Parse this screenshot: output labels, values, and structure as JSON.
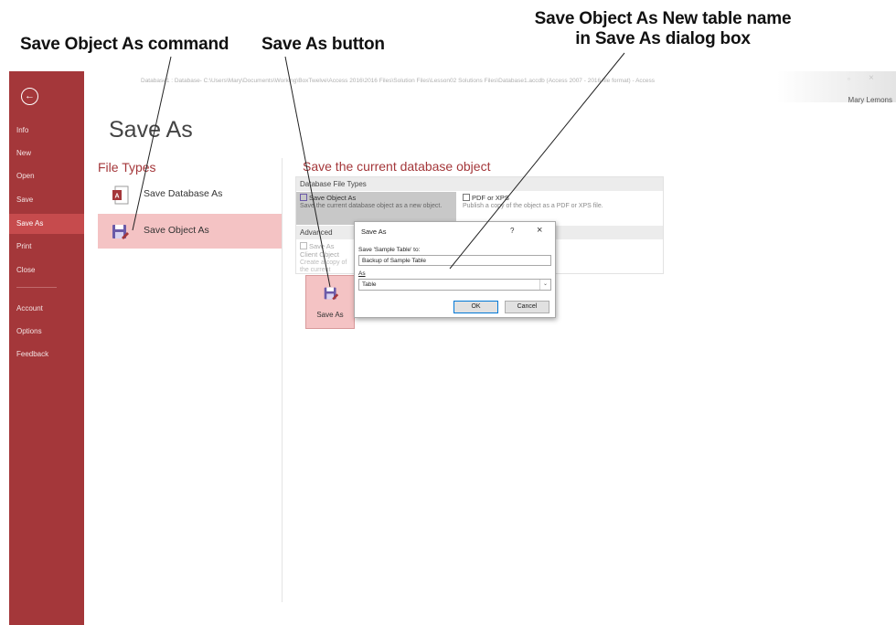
{
  "callouts": {
    "save_object_as_command": "Save Object As command",
    "save_as_button": "Save As button",
    "new_table_name_line1": "Save Object As  New table name",
    "new_table_name_line2": "in Save As dialog box"
  },
  "window": {
    "title": "Database1 : Database- C:\\Users\\Mary\\Documents\\Working\\BoxTwelve\\Access 2016\\2016 Files\\Solution Files\\Lesson02 Solutions Files\\Database1.accdb (Access 2007 - 2016 file format) - Access",
    "help_glyph": "?",
    "close_glyph": "×",
    "restore_glyph": "▫",
    "user": "Mary Lemons"
  },
  "sidebar": {
    "back_glyph": "←",
    "items": [
      {
        "label": "Info"
      },
      {
        "label": "New"
      },
      {
        "label": "Open"
      },
      {
        "label": "Save"
      },
      {
        "label": "Save As"
      },
      {
        "label": "Print"
      },
      {
        "label": "Close"
      },
      {
        "label": "Account"
      },
      {
        "label": "Options"
      },
      {
        "label": "Feedback"
      }
    ]
  },
  "main": {
    "title": "Save As",
    "file_types_heading": "File Types",
    "file_types": [
      {
        "label": "Save Database As"
      },
      {
        "label": "Save Object As"
      }
    ],
    "current_heading": "Save the current database object",
    "db_file_types_header": "Database File Types",
    "save_object_as_title": "Save Object As",
    "save_object_as_desc": "Save the current database object as a new object.",
    "pdf_title": "PDF or XPS",
    "pdf_desc": "Publish a copy of the object as a PDF or XPS file.",
    "advanced_header": "Advanced",
    "client_title": "Save As Client Object",
    "client_desc": "Create a copy of the current object as a client object",
    "save_as_button": "Save As"
  },
  "dialog": {
    "title": "Save As",
    "help": "?",
    "close": "×",
    "name_label": "Save 'Sample Table' to:",
    "name_value": "Backup of Sample Table",
    "as_label": "As",
    "as_value": "Table",
    "dropdown_glyph": "⌄",
    "ok": "OK",
    "cancel": "Cancel"
  },
  "colors": {
    "sidebar": "#a4373a",
    "sidebar_active": "#c64b4d",
    "selection": "#f4c3c4",
    "accent_text": "#a4373a"
  }
}
